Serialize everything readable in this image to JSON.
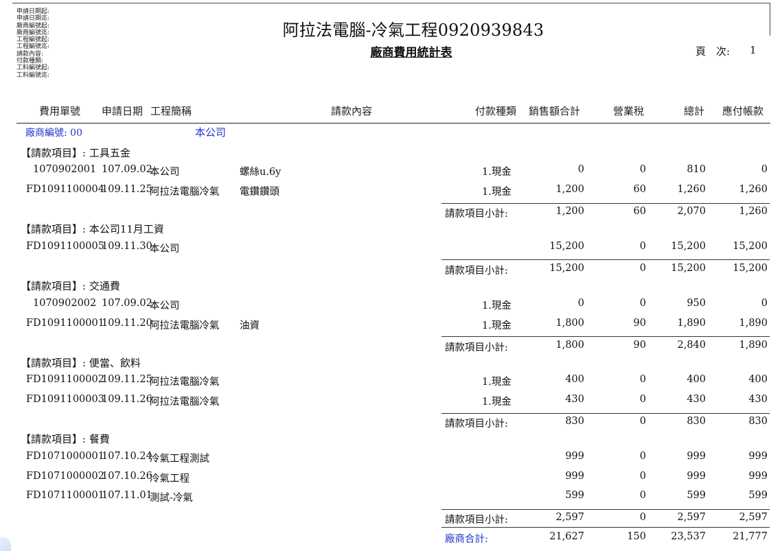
{
  "filters": [
    "申請日期起:",
    "申請日期迄:",
    "廠商編號起:",
    "廠商編號迄:",
    "工程編號起:",
    "工程編號迄:",
    "請款內容:",
    "付款種類:",
    "工料編號起:",
    "工料編號迄:"
  ],
  "company_title": "阿拉法電腦-冷氣工程0920939843",
  "report_title": "廠商費用統計表",
  "page_label": "頁　次:",
  "page_number": "1",
  "headers": {
    "fee_no": "費用單號",
    "apply_date": "申請日期",
    "project": "工程簡稱",
    "content": "請款內容",
    "pay_type": "付款種類",
    "sales_total": "銷售額合計",
    "tax": "營業稅",
    "total": "總計",
    "payable": "應付帳款"
  },
  "vendor_label": "廠商編號: 00",
  "vendor_name": "本公司",
  "subtotal_label": "請款項目小計:",
  "vendor_total_label": "廠商合計:",
  "groups": [
    {
      "title": "【請款項目】: 工具五金",
      "rows": [
        {
          "no": "1070902001",
          "date": "107.09.02",
          "project": "本公司",
          "content": "螺絲u.6y",
          "pay": "1.現金",
          "sales": "0",
          "tax": "0",
          "total": "810",
          "payable": "0"
        },
        {
          "no": "FD1091100004",
          "date": "109.11.25",
          "project": "阿拉法電腦冷氣",
          "content": "電鑽鑽頭",
          "pay": "1.現金",
          "sales": "1,200",
          "tax": "60",
          "total": "1,260",
          "payable": "1,260"
        }
      ],
      "subtotal": {
        "sales": "1,200",
        "tax": "60",
        "total": "2,070",
        "payable": "1,260"
      }
    },
    {
      "title": "【請款項目】: 本公司11月工資",
      "rows": [
        {
          "no": "FD1091100005",
          "date": "109.11.30",
          "project": "本公司",
          "content": "",
          "pay": "",
          "sales": "15,200",
          "tax": "0",
          "total": "15,200",
          "payable": "15,200"
        }
      ],
      "subtotal": {
        "sales": "15,200",
        "tax": "0",
        "total": "15,200",
        "payable": "15,200"
      }
    },
    {
      "title": "【請款項目】: 交通費",
      "rows": [
        {
          "no": "1070902002",
          "date": "107.09.02",
          "project": "本公司",
          "content": "",
          "pay": "1.現金",
          "sales": "0",
          "tax": "0",
          "total": "950",
          "payable": "0"
        },
        {
          "no": "FD1091100001",
          "date": "109.11.20",
          "project": "阿拉法電腦冷氣",
          "content": "油資",
          "pay": "1.現金",
          "sales": "1,800",
          "tax": "90",
          "total": "1,890",
          "payable": "1,890"
        }
      ],
      "subtotal": {
        "sales": "1,800",
        "tax": "90",
        "total": "2,840",
        "payable": "1,890"
      }
    },
    {
      "title": "【請款項目】: 便當、飲料",
      "rows": [
        {
          "no": "FD1091100002",
          "date": "109.11.25",
          "project": "阿拉法電腦冷氣",
          "content": "",
          "pay": "1.現金",
          "sales": "400",
          "tax": "0",
          "total": "400",
          "payable": "400"
        },
        {
          "no": "FD1091100003",
          "date": "109.11.26",
          "project": "阿拉法電腦冷氣",
          "content": "",
          "pay": "1.現金",
          "sales": "430",
          "tax": "0",
          "total": "430",
          "payable": "430"
        }
      ],
      "subtotal": {
        "sales": "830",
        "tax": "0",
        "total": "830",
        "payable": "830"
      }
    },
    {
      "title": "【請款項目】: 餐費",
      "rows": [
        {
          "no": "FD1071000001",
          "date": "107.10.24",
          "project": "冷氣工程測試",
          "content": "",
          "pay": "",
          "sales": "999",
          "tax": "0",
          "total": "999",
          "payable": "999"
        },
        {
          "no": "FD1071000002",
          "date": "107.10.26",
          "project": "冷氣工程",
          "content": "",
          "pay": "",
          "sales": "999",
          "tax": "0",
          "total": "999",
          "payable": "999"
        },
        {
          "no": "FD1071100001",
          "date": "107.11.01",
          "project": "測試-冷氣",
          "content": "",
          "pay": "",
          "sales": "599",
          "tax": "0",
          "total": "599",
          "payable": "599"
        }
      ],
      "subtotal": {
        "sales": "2,597",
        "tax": "0",
        "total": "2,597",
        "payable": "2,597"
      }
    }
  ],
  "vendor_total": {
    "sales": "21,627",
    "tax": "150",
    "total": "23,537",
    "payable": "21,777"
  }
}
